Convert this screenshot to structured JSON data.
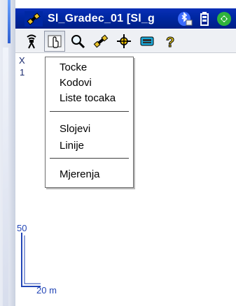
{
  "titlebar": {
    "title": "Sl_Gradec_01 [Sl_g",
    "icons": [
      "app-satellite-icon",
      "bluetooth-icon",
      "battery-icon",
      "gps-status-icon"
    ]
  },
  "toolbar": {
    "tools": [
      {
        "name": "survey-pole-icon",
        "label": ""
      },
      {
        "name": "pointer-hand-icon",
        "label": ""
      },
      {
        "name": "zoom-magnifier-icon",
        "label": ""
      },
      {
        "name": "satellite-icon",
        "label": ""
      },
      {
        "name": "crosshair-icon",
        "label": ""
      },
      {
        "name": "keyboard-icon",
        "label": ""
      },
      {
        "name": "help-icon",
        "label": ""
      }
    ]
  },
  "menu": {
    "items": [
      "Tocke",
      "Kodovi",
      "Liste tocaka",
      "Slojevi",
      "Linije",
      "Mjerenja"
    ]
  },
  "map": {
    "axis_x": "X",
    "axis_1": "1",
    "scale_vertical": "50",
    "scale_horizontal": "20 m"
  },
  "colors": {
    "titlebar": "#0028a4",
    "scale": "#2346b6"
  }
}
